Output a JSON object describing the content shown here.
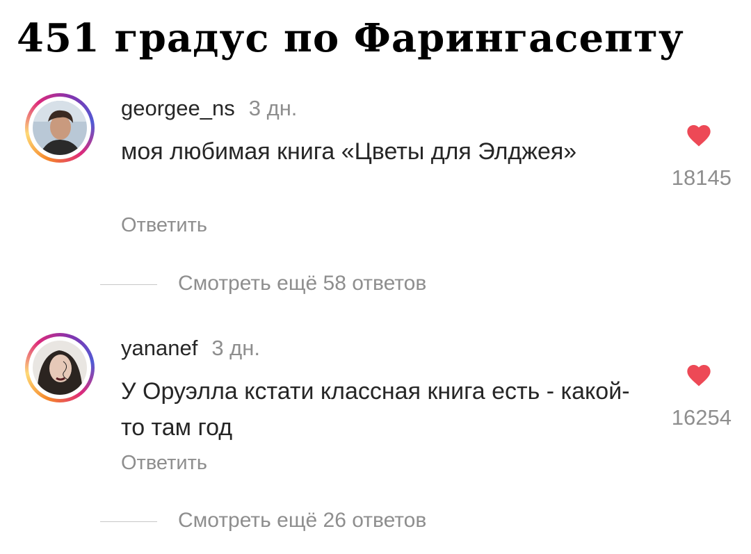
{
  "headline": "451 градус по Фарингасепту",
  "comments": [
    {
      "username": "georgee_ns",
      "time": "3 дн.",
      "text": "моя любимая книга «Цветы для Элджея»",
      "reply_label": "Ответить",
      "likes": "18145",
      "more_replies": "Смотреть ещё 58 ответов"
    },
    {
      "username": "yananef",
      "time": "3 дн.",
      "text": "У Оруэлла кстати классная книга есть - какой-то там год",
      "reply_label": "Ответить",
      "likes": "16254",
      "more_replies": "Смотреть ещё 26 ответов"
    }
  ],
  "icons": {
    "like": "heart-icon"
  },
  "colors": {
    "heart": "#ed4956",
    "secondary_text": "#8e8e8e"
  }
}
